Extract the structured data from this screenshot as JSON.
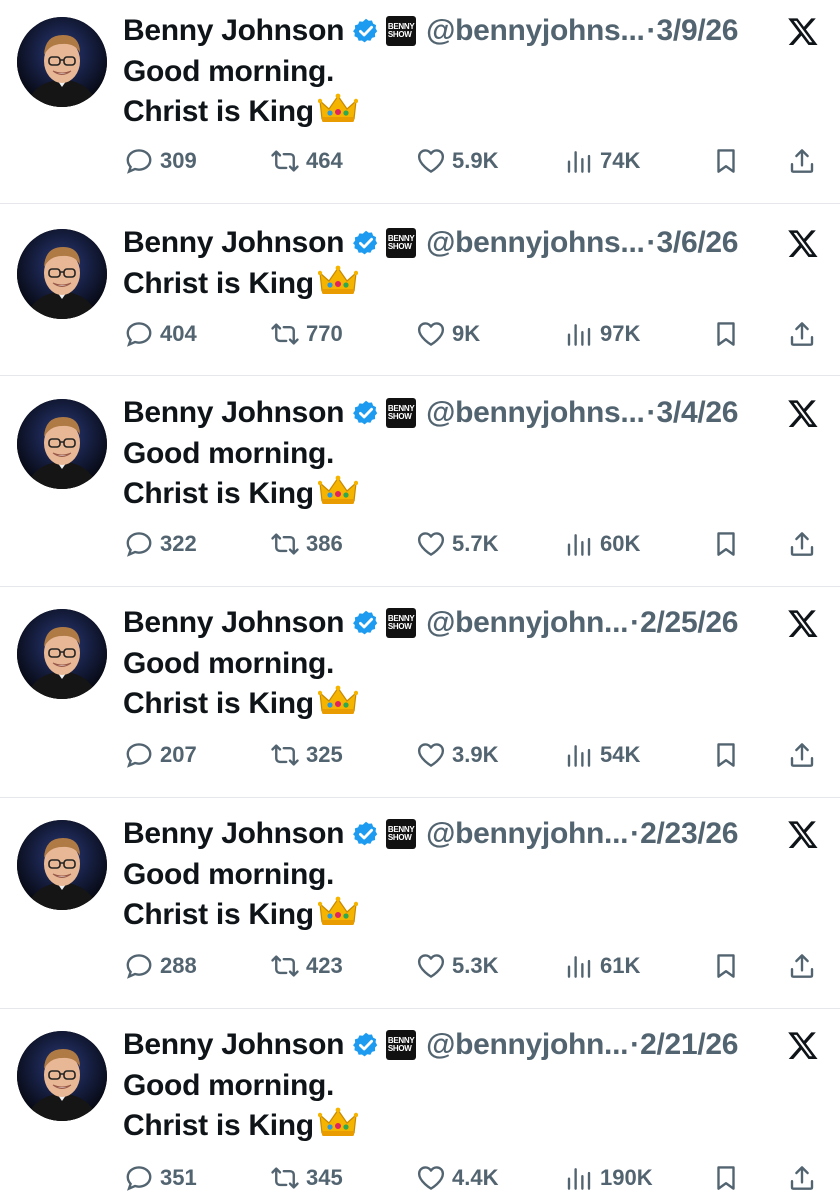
{
  "tweets": [
    {
      "author_name": "Benny Johnson",
      "affiliation_badge": "BENNY SHOW",
      "handle": "@bennyjohns...",
      "separator": "·",
      "date": "3/9/26",
      "text_lines": [
        "Good morning.",
        "Christ is King"
      ],
      "emoji": "crown",
      "replies": "309",
      "reposts": "464",
      "likes": "5.9K",
      "views": "74K"
    },
    {
      "author_name": "Benny Johnson",
      "affiliation_badge": "BENNY SHOW",
      "handle": "@bennyjohns...",
      "separator": "·",
      "date": "3/6/26",
      "text_lines": [
        "Christ is King"
      ],
      "emoji": "crown",
      "replies": "404",
      "reposts": "770",
      "likes": "9K",
      "views": "97K"
    },
    {
      "author_name": "Benny Johnson",
      "affiliation_badge": "BENNY SHOW",
      "handle": "@bennyjohns...",
      "separator": "·",
      "date": "3/4/26",
      "text_lines": [
        "Good morning.",
        "Christ is King"
      ],
      "emoji": "crown",
      "replies": "322",
      "reposts": "386",
      "likes": "5.7K",
      "views": "60K"
    },
    {
      "author_name": "Benny Johnson",
      "affiliation_badge": "BENNY SHOW",
      "handle": "@bennyjohn...",
      "separator": "·",
      "date": "2/25/26",
      "text_lines": [
        "Good morning.",
        "Christ is King"
      ],
      "emoji": "crown",
      "replies": "207",
      "reposts": "325",
      "likes": "3.9K",
      "views": "54K"
    },
    {
      "author_name": "Benny Johnson",
      "affiliation_badge": "BENNY SHOW",
      "handle": "@bennyjohn...",
      "separator": "·",
      "date": "2/23/26",
      "text_lines": [
        "Good morning.",
        "Christ is King"
      ],
      "emoji": "crown",
      "replies": "288",
      "reposts": "423",
      "likes": "5.3K",
      "views": "61K"
    },
    {
      "author_name": "Benny Johnson",
      "affiliation_badge": "BENNY SHOW",
      "handle": "@bennyjohn...",
      "separator": "·",
      "date": "2/21/26",
      "text_lines": [
        "Good morning.",
        "Christ is King"
      ],
      "emoji": "crown",
      "replies": "351",
      "reposts": "345",
      "likes": "4.4K",
      "views": "190K"
    }
  ],
  "icons": {
    "verified": "verified-badge-icon",
    "platform": "x-logo-icon",
    "reply": "reply-icon",
    "repost": "repost-icon",
    "like": "heart-icon",
    "views": "views-icon",
    "bookmark": "bookmark-icon",
    "share": "share-icon"
  },
  "colors": {
    "text": "#0f1419",
    "muted": "#536471",
    "verified": "#1d9bf0",
    "divider": "#e5e7eb"
  }
}
